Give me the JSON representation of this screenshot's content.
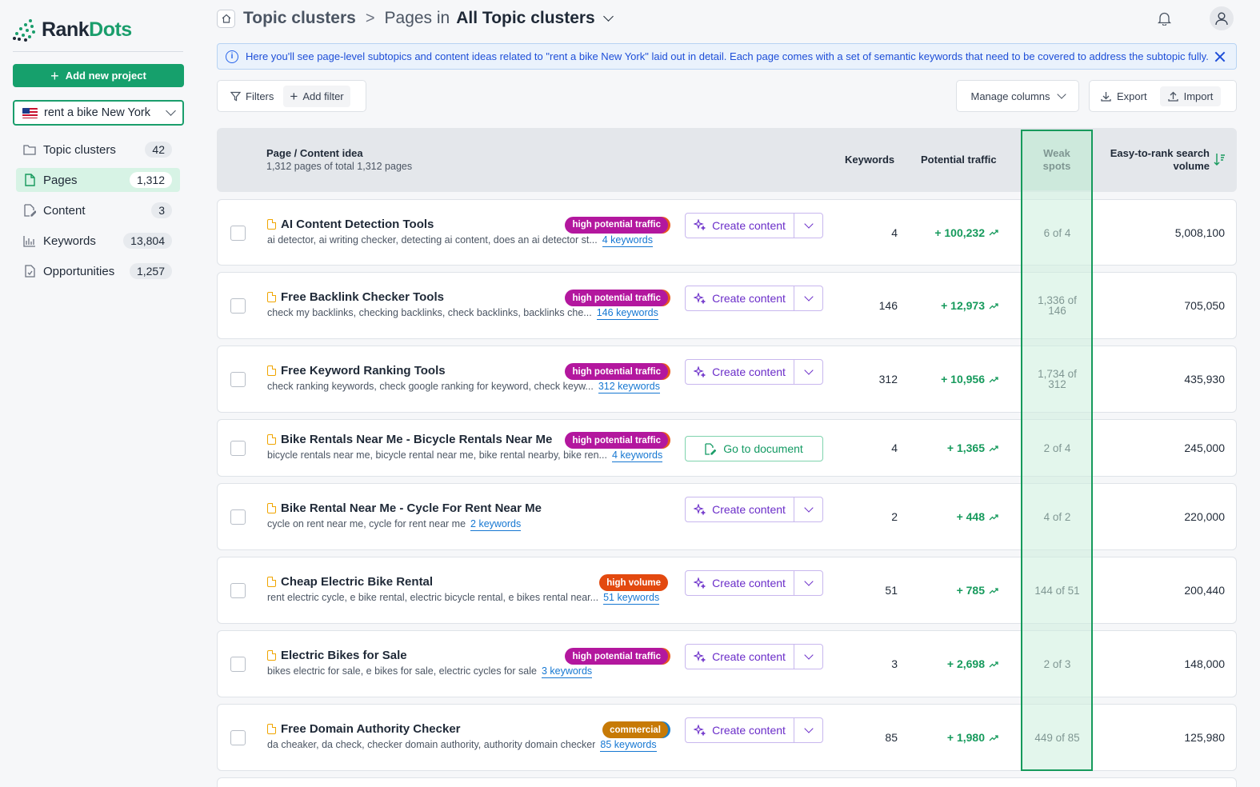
{
  "app": {
    "logo_rank": "Rank",
    "logo_dots": "Dots",
    "add_project_label": "Add new project",
    "project": "rent a bike New York"
  },
  "nav": [
    {
      "label": "Topic clusters",
      "count": "42",
      "icon": "folder-icon",
      "active": false
    },
    {
      "label": "Pages",
      "count": "1,312",
      "icon": "page-icon",
      "active": true
    },
    {
      "label": "Content",
      "count": "3",
      "icon": "content-edit-icon",
      "active": false
    },
    {
      "label": "Keywords",
      "count": "13,804",
      "icon": "bar-chart-icon",
      "active": false
    },
    {
      "label": "Opportunities",
      "count": "1,257",
      "icon": "opportunity-doc-icon",
      "active": false
    }
  ],
  "header": {
    "crumb_root": "Topic clusters",
    "crumb_separator": ">",
    "crumb_prefix": "Pages in",
    "crumb_current": "All Topic clusters"
  },
  "info": {
    "text": "Here you'll see page-level subtopics and content ideas related to \"rent a bike New York\" laid out in detail. Each page comes with a set of semantic keywords that need to be covered to address the subtopic fully."
  },
  "toolbar": {
    "filters_label": "Filters",
    "add_filter_label": "Add filter",
    "manage_columns_label": "Manage columns",
    "export_label": "Export",
    "import_label": "Import"
  },
  "table": {
    "col_page": "Page / Content idea",
    "col_page_sub": "1,312 pages of total 1,312 pages",
    "col_keywords": "Keywords",
    "col_traffic": "Potential traffic",
    "col_weak_line1": "Weak",
    "col_weak_line2": "spots",
    "col_volume_line1": "Easy-to-rank search",
    "col_volume_line2": "volume",
    "rows": [
      {
        "title": "AI Content Detection Tools",
        "keywords_text": "ai detector, ai writing checker, detecting ai content, does an ai detector st...",
        "keywords_link": "4 keywords",
        "badge": "high potential traffic",
        "badge_type": "hpt",
        "action": "Create content",
        "action_type": "create",
        "keywords": "4",
        "traffic": "+ 100,232",
        "weak_1": "6 of 4",
        "weak_2": "",
        "volume": "5,008,100"
      },
      {
        "title": "Free Backlink Checker Tools",
        "keywords_text": "check my backlinks, checking backlinks, check backlinks, backlinks che...",
        "keywords_link": "146 keywords",
        "badge": "high potential traffic",
        "badge_type": "hpt",
        "action": "Create content",
        "action_type": "create",
        "keywords": "146",
        "traffic": "+ 12,973",
        "weak_1": "1,336 of",
        "weak_2": "146",
        "volume": "705,050"
      },
      {
        "title": "Free Keyword Ranking Tools",
        "keywords_text": "check ranking keywords, check google ranking for keyword, check keyw...",
        "keywords_link": "312 keywords",
        "badge": "high potential traffic",
        "badge_type": "hpt",
        "action": "Create content",
        "action_type": "create",
        "keywords": "312",
        "traffic": "+ 10,956",
        "weak_1": "1,734 of",
        "weak_2": "312",
        "volume": "435,930"
      },
      {
        "title": "Bike Rentals Near Me - Bicycle Rentals Near Me",
        "keywords_text": "bicycle rentals near me, bicycle rental near me, bike rental nearby, bike ren...",
        "keywords_link": "4 keywords",
        "badge": "high potential traffic",
        "badge_type": "hpt",
        "action": "Go to document",
        "action_type": "go",
        "keywords": "4",
        "traffic": "+ 1,365",
        "weak_1": "2 of 4",
        "weak_2": "",
        "volume": "245,000"
      },
      {
        "title": "Bike Rental Near Me - Cycle For Rent Near Me",
        "keywords_text": "cycle on rent near me, cycle for rent near me",
        "keywords_link": "2 keywords",
        "badge": "",
        "badge_type": "",
        "action": "Create content",
        "action_type": "create",
        "keywords": "2",
        "traffic": "+ 448",
        "weak_1": "4 of 2",
        "weak_2": "",
        "volume": "220,000"
      },
      {
        "title": "Cheap Electric Bike Rental",
        "keywords_text": "rent electric cycle, e bike rental, electric bicycle rental, e bikes rental near...",
        "keywords_link": "51 keywords",
        "badge": "high volume",
        "badge_type": "hv",
        "action": "Create content",
        "action_type": "create",
        "keywords": "51",
        "traffic": "+ 785",
        "weak_1": "144 of 51",
        "weak_2": "",
        "volume": "200,440"
      },
      {
        "title": "Electric Bikes for Sale",
        "keywords_text": "bikes electric for sale, e bikes for sale, electric cycles for sale",
        "keywords_link": "3 keywords",
        "badge": "high potential traffic",
        "badge_type": "hpt",
        "action": "Create content",
        "action_type": "create",
        "keywords": "3",
        "traffic": "+ 2,698",
        "weak_1": "2 of 3",
        "weak_2": "",
        "volume": "148,000"
      },
      {
        "title": "Free Domain Authority Checker",
        "keywords_text": "da cheaker, da check, checker domain authority, authority domain checker",
        "keywords_link": "85 keywords",
        "badge": "commercial",
        "badge_type": "com",
        "action": "Create content",
        "action_type": "create",
        "keywords": "85",
        "traffic": "+ 1,980",
        "weak_1": "449 of 85",
        "weak_2": "",
        "volume": "125,980"
      }
    ]
  },
  "colors": {
    "brand": "#1a9e6c",
    "accent_purple": "#6b2ec9",
    "traffic_green": "#169a5c",
    "badge_high_potential": "#b3179e",
    "badge_high_volume": "#e3490f",
    "badge_commercial": "#c77a06"
  }
}
